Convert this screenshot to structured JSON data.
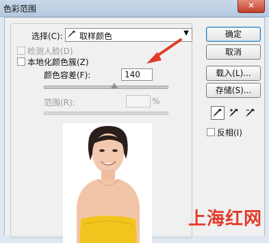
{
  "window": {
    "title": "色彩范围",
    "close_label": "✕"
  },
  "select": {
    "label": "选择(C):",
    "value": "取样颜色",
    "icon": "eyedropper-icon"
  },
  "detect_faces": {
    "label": "检测人脸(D)",
    "checked": false,
    "enabled": false
  },
  "localized_clusters": {
    "label": "本地化颜色簇(Z)",
    "checked": false
  },
  "fuzziness": {
    "label": "颜色容差(F):",
    "value": "140",
    "slider_fraction": 0.57
  },
  "range": {
    "label": "范围(R):",
    "value": "",
    "unit": "%"
  },
  "buttons": {
    "ok": "确定",
    "cancel": "取消",
    "load": "载入(L)...",
    "save": "存储(S)..."
  },
  "eyedroppers": [
    "eyedropper-icon",
    "eyedropper-plus-icon",
    "eyedropper-minus-icon"
  ],
  "invert": {
    "label": "反相(I)",
    "checked": false
  },
  "watermark": "上海红网",
  "colors": {
    "annotation_arrow": "#e23a2a",
    "title_bar": "#c9d9ea"
  }
}
